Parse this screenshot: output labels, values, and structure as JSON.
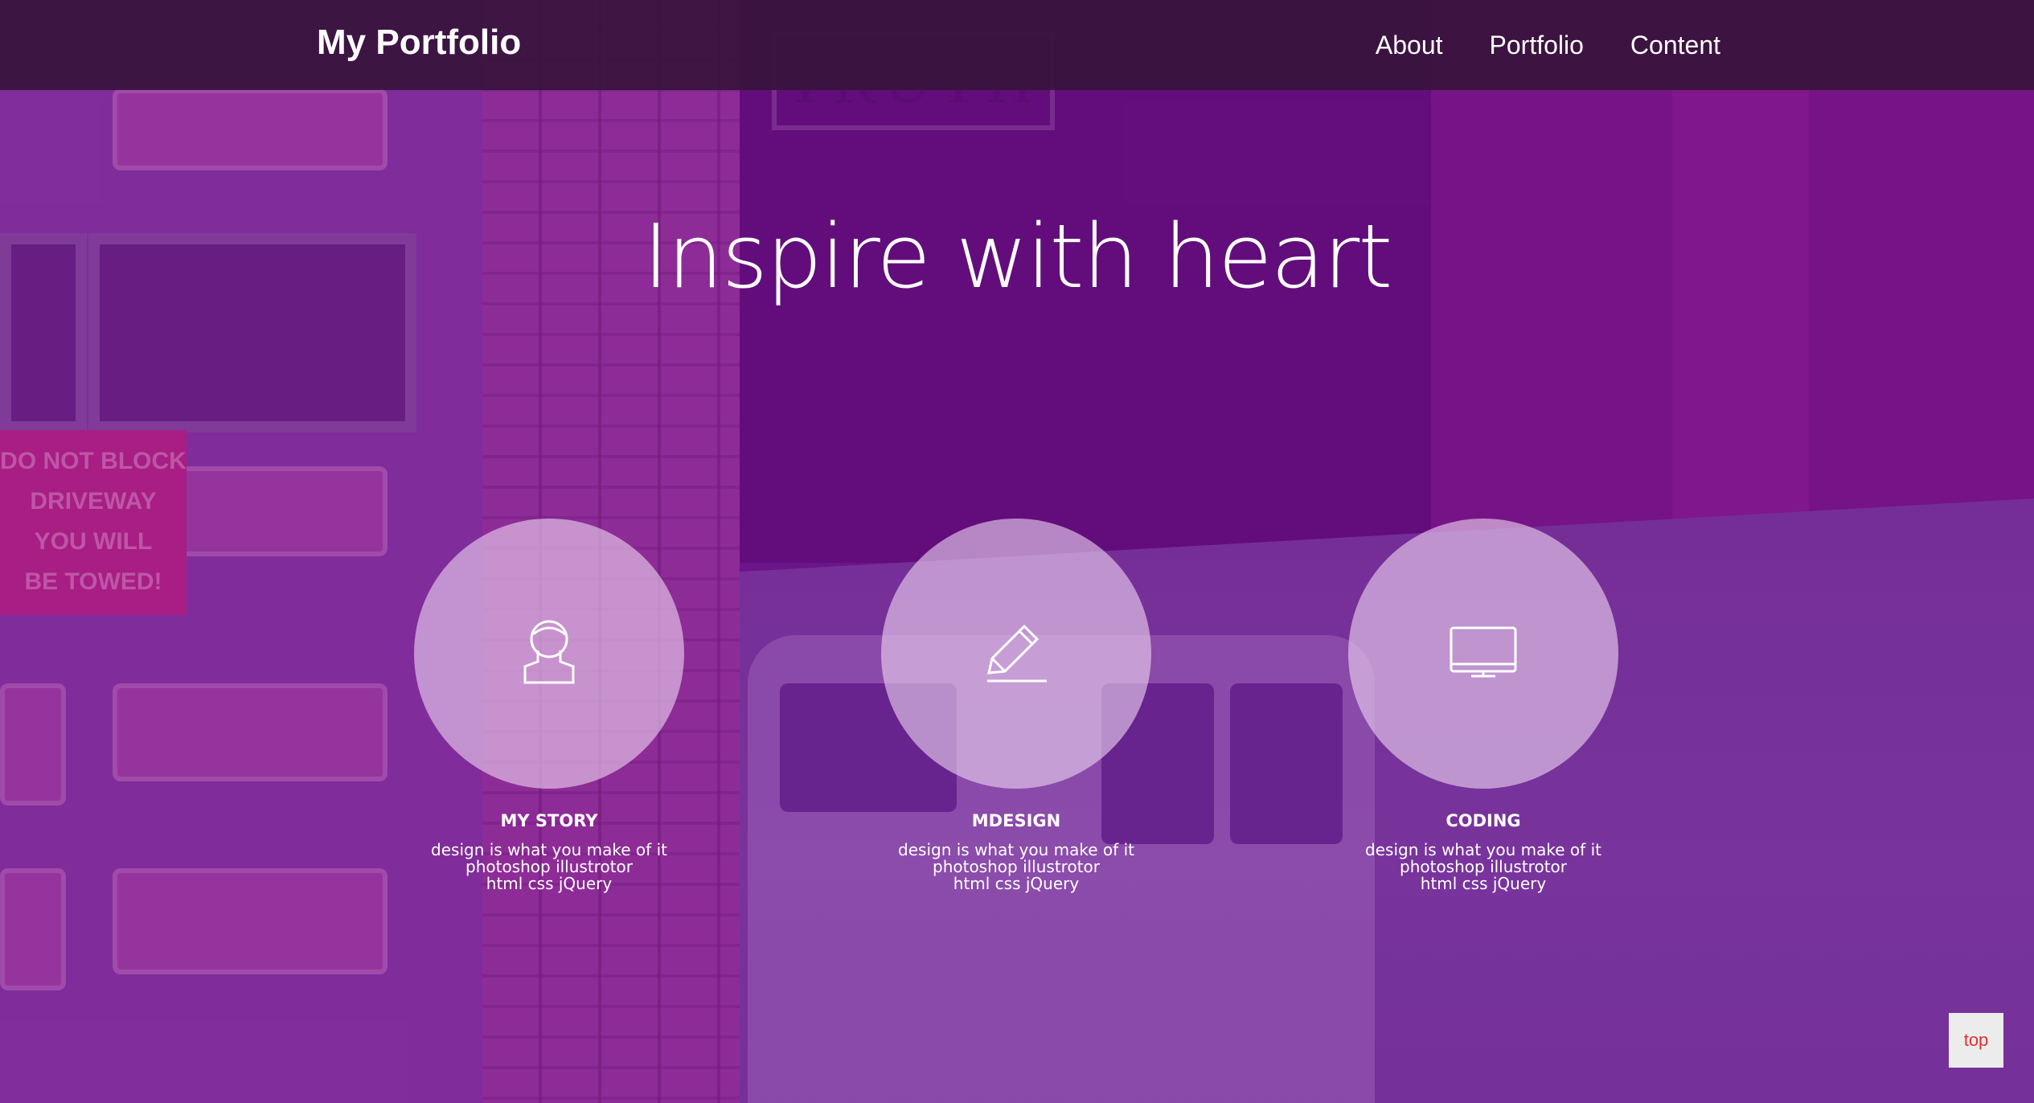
{
  "header": {
    "logo": "My Portfolio",
    "nav": [
      "About",
      "Portfolio",
      "Content"
    ]
  },
  "hero": {
    "title": "Inspire with heart"
  },
  "cards": [
    {
      "icon": "person-icon",
      "title": "MY STORY",
      "lines": [
        "design is what you make of it",
        "photoshop illustrotor",
        "html css jQuery"
      ]
    },
    {
      "icon": "pencil-icon",
      "title": "MDESIGN",
      "lines": [
        "design is what you make of it",
        "photoshop illustrotor",
        "html css jQuery"
      ]
    },
    {
      "icon": "monitor-icon",
      "title": "CODING",
      "lines": [
        "design is what you make of it",
        "photoshop illustrotor",
        "html css jQuery"
      ]
    }
  ],
  "top_button": "top",
  "background": {
    "sign_text": [
      "DO NOT BLOCK",
      "DRIVEWAY",
      "YOU WILL",
      "BE TOWED!"
    ],
    "truth_text": "TRUTH"
  },
  "colors": {
    "overlay": "#6e1496",
    "header_bg": "#37143c",
    "top_text": "#e03030"
  }
}
